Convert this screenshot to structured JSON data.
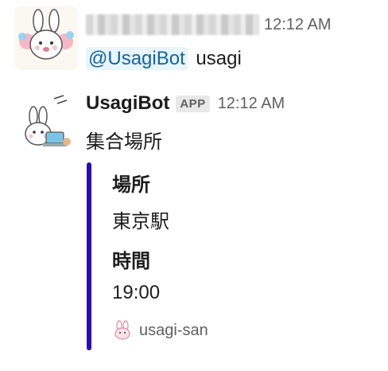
{
  "messages": [
    {
      "sender_name": "",
      "time": "12:12 AM",
      "mention": "@UsagiBot",
      "text": "usagi"
    },
    {
      "sender_name": "UsagiBot",
      "badge": "APP",
      "time": "12:12 AM",
      "text": "集合場所",
      "attachment": {
        "bar_color": "#2a0bb8",
        "fields": [
          {
            "title": "場所",
            "value": "東京駅"
          },
          {
            "title": "時間",
            "value": "19:00"
          }
        ],
        "footer": "usagi-san"
      }
    }
  ]
}
